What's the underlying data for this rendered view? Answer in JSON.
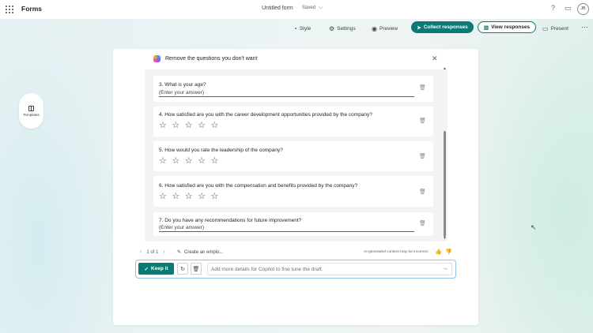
{
  "app": {
    "name": "Forms",
    "form_title": "Untitled form",
    "save_status": "Saved",
    "avatar_initials": "JB"
  },
  "toolbar": {
    "style_label": "Style",
    "settings_label": "Settings",
    "preview_label": "Preview",
    "collect_label": "Collect responses",
    "view_label": "View responses",
    "present_label": "Present"
  },
  "sidebar": {
    "templates_label": "Templates"
  },
  "copilot_panel": {
    "title": "Remove the questions you don't want",
    "questions": [
      {
        "text": "3. What is your age?",
        "type": "text",
        "placeholder": "(Enter your answer)"
      },
      {
        "text": "4. How satisfied are you with the career development opportunities provided by the company?",
        "type": "rating",
        "stars": 5
      },
      {
        "text": "5. How would you rate the leadership of the company?",
        "type": "rating",
        "stars": 5
      },
      {
        "text": "6. How satisfied are you with the compensation and benefits provided by the company?",
        "type": "rating",
        "stars": 5
      },
      {
        "text": "7. Do you have any recommendations for future improvement?",
        "type": "text",
        "placeholder": "(Enter your answer)"
      }
    ]
  },
  "footer": {
    "pager": "1 of 1",
    "prompt_echo": "Create an emplo...",
    "ai_note": "AI-generated content may be incorrect",
    "keep_label": "Keep it",
    "input_placeholder": "Add more details for Copilot to fine tune the draft."
  },
  "colors": {
    "accent": "#0b7a75",
    "input_border": "#8fc4e8"
  }
}
